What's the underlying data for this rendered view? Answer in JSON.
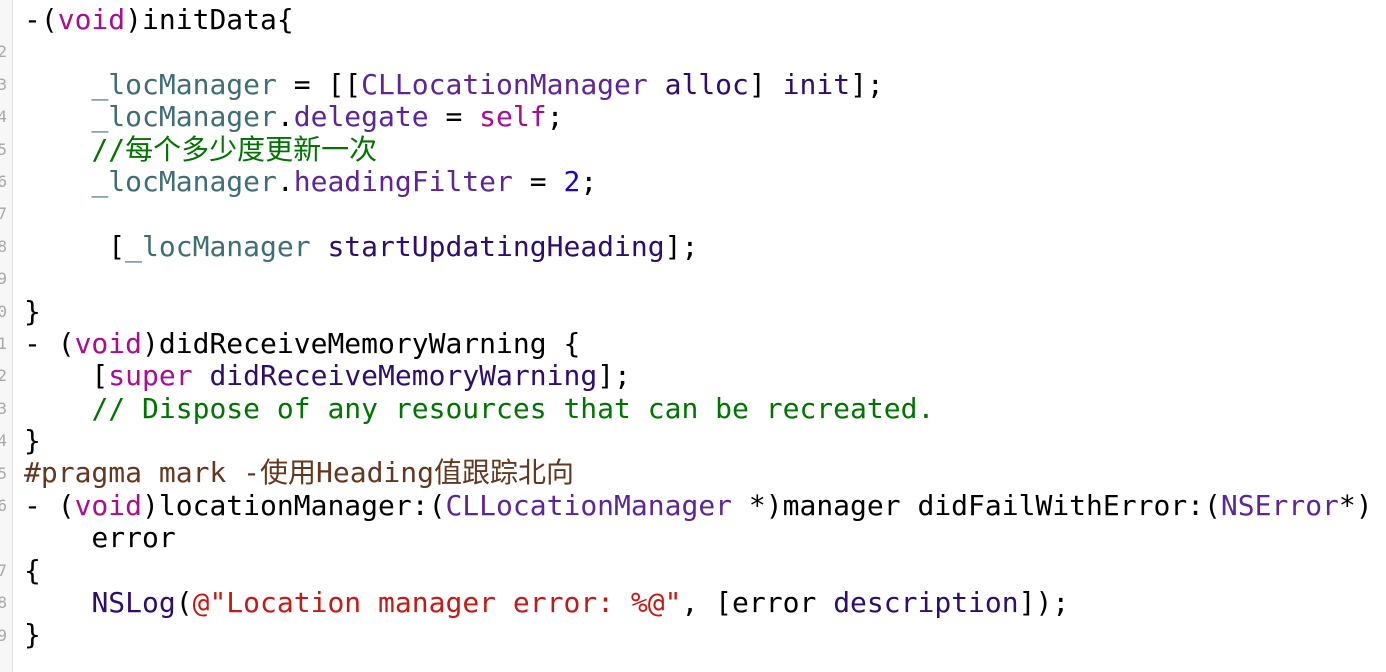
{
  "gutter": {
    "line_number_digits": [
      "",
      "2",
      "3",
      "4",
      "5",
      "6",
      "7",
      "8",
      "9",
      "0",
      "1",
      "2",
      "3",
      "4",
      "5",
      "6",
      "",
      "7",
      "8",
      "9"
    ]
  },
  "colors": {
    "keyword": "#AA0D91",
    "instance_variable": "#3F6E74",
    "class_name": "#5C2699",
    "method": "#2E0D6E",
    "number": "#1C00CF",
    "comment": "#007400",
    "string": "#C41A16",
    "pragma": "#643820"
  },
  "code": {
    "lines": [
      [
        [
          "-(",
          "plain"
        ],
        [
          "void",
          "kw"
        ],
        [
          ")initData{",
          "plain"
        ]
      ],
      [],
      [
        [
          "    ",
          "plain"
        ],
        [
          "_locManager",
          "ivar"
        ],
        [
          " = [[",
          "plain"
        ],
        [
          "CLLocationManager",
          "class"
        ],
        [
          " ",
          "plain"
        ],
        [
          "alloc",
          "meth"
        ],
        [
          "] ",
          "plain"
        ],
        [
          "init",
          "meth"
        ],
        [
          "];",
          "plain"
        ]
      ],
      [
        [
          "    ",
          "plain"
        ],
        [
          "_locManager",
          "ivar"
        ],
        [
          ".",
          "plain"
        ],
        [
          "delegate",
          "prop"
        ],
        [
          " = ",
          "plain"
        ],
        [
          "self",
          "kw"
        ],
        [
          ";",
          "plain"
        ]
      ],
      [
        [
          "    ",
          "plain"
        ],
        [
          "//每个多少度更新一次",
          "com"
        ]
      ],
      [
        [
          "    ",
          "plain"
        ],
        [
          "_locManager",
          "ivar"
        ],
        [
          ".",
          "plain"
        ],
        [
          "headingFilter",
          "prop"
        ],
        [
          " = ",
          "plain"
        ],
        [
          "2",
          "num"
        ],
        [
          ";",
          "plain"
        ]
      ],
      [],
      [
        [
          "     [",
          "plain"
        ],
        [
          "_locManager",
          "ivar"
        ],
        [
          " ",
          "plain"
        ],
        [
          "startUpdatingHeading",
          "meth"
        ],
        [
          "];",
          "plain"
        ]
      ],
      [],
      [
        [
          "}",
          "plain"
        ]
      ],
      [
        [
          "- (",
          "plain"
        ],
        [
          "void",
          "kw"
        ],
        [
          ")didReceiveMemoryWarning {",
          "plain"
        ]
      ],
      [
        [
          "    [",
          "plain"
        ],
        [
          "super",
          "kw"
        ],
        [
          " ",
          "plain"
        ],
        [
          "didReceiveMemoryWarning",
          "meth"
        ],
        [
          "];",
          "plain"
        ]
      ],
      [
        [
          "    ",
          "plain"
        ],
        [
          "// Dispose of any resources that can be recreated.",
          "com"
        ]
      ],
      [
        [
          "}",
          "plain"
        ]
      ],
      [
        [
          "#pragma mark -使用Heading值跟踪北向",
          "pragma"
        ]
      ],
      [
        [
          "- (",
          "plain"
        ],
        [
          "void",
          "kw"
        ],
        [
          ")locationManager:(",
          "plain"
        ],
        [
          "CLLocationManager",
          "class"
        ],
        [
          " *)manager didFailWithError:(",
          "plain"
        ],
        [
          "NSError",
          "class"
        ],
        [
          "*)",
          "plain"
        ]
      ],
      [
        [
          "    error",
          "plain"
        ]
      ],
      [
        [
          "{",
          "plain"
        ]
      ],
      [
        [
          "    ",
          "plain"
        ],
        [
          "NSLog",
          "meth"
        ],
        [
          "(",
          "plain"
        ],
        [
          "@\"Location manager error: %@\"",
          "str"
        ],
        [
          ", [error ",
          "plain"
        ],
        [
          "description",
          "meth"
        ],
        [
          "]);",
          "plain"
        ]
      ],
      [
        [
          "}",
          "plain"
        ]
      ]
    ]
  }
}
